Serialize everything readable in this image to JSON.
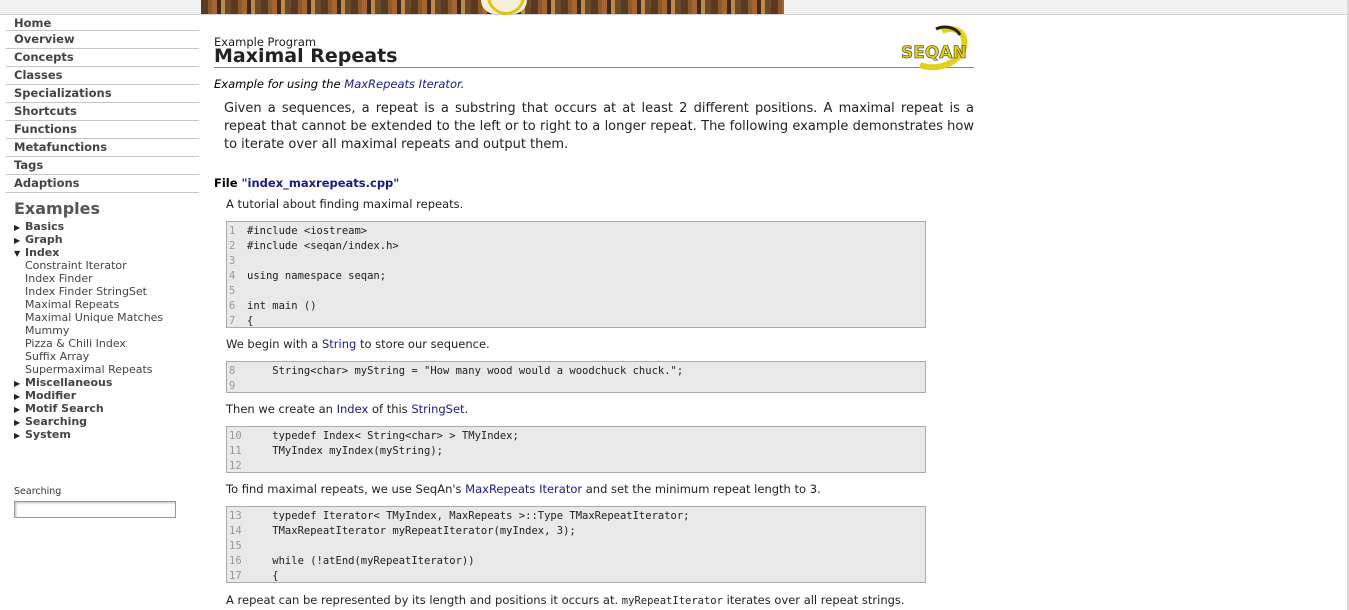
{
  "nav": {
    "items": [
      "Home",
      "Overview",
      "Concepts",
      "Classes",
      "Specializations",
      "Shortcuts",
      "Functions",
      "Metafunctions",
      "Tags",
      "Adaptions"
    ]
  },
  "examples": {
    "heading": "Examples",
    "groups": [
      {
        "label": "Basics",
        "expanded": false
      },
      {
        "label": "Graph",
        "expanded": false
      },
      {
        "label": "Index",
        "expanded": true,
        "children": [
          "Constraint Iterator",
          "Index Finder",
          "Index Finder StringSet",
          "Maximal Repeats",
          "Maximal Unique Matches",
          "Mummy",
          "Pizza & Chili Index",
          "Suffix Array",
          "Supermaximal Repeats"
        ]
      },
      {
        "label": "Miscellaneous",
        "expanded": false
      },
      {
        "label": "Modifier",
        "expanded": false
      },
      {
        "label": "Motif Search",
        "expanded": false
      },
      {
        "label": "Searching",
        "expanded": false
      },
      {
        "label": "System",
        "expanded": false
      }
    ]
  },
  "search": {
    "label": "Searching",
    "value": ""
  },
  "page": {
    "subtitle": "Example Program",
    "title": "Maximal Repeats",
    "logo_text": "SEQAN",
    "lead_prefix": "Example for using the ",
    "lead_link": "MaxRepeats Iterator",
    "lead_suffix": ".",
    "intro": "Given a sequences, a repeat is a substring that occurs at at least 2 different positions. A maximal repeat is a repeat that cannot be extended to the left or to right to a longer repeat. The following example demonstrates how to iterate over all maximal repeats and output them.",
    "file_prefix": "File ",
    "file_name": "\"index_maxrepeats.cpp\""
  },
  "sections": {
    "p1": "A tutorial about finding maximal repeats.",
    "code1": [
      [
        "1",
        "#include <iostream>"
      ],
      [
        "2",
        "#include <seqan/index.h>"
      ],
      [
        "3",
        ""
      ],
      [
        "4",
        "using namespace seqan;"
      ],
      [
        "5",
        ""
      ],
      [
        "6",
        "int main ()"
      ],
      [
        "7",
        "{"
      ]
    ],
    "p2_a": "We begin with a ",
    "p2_link": "String",
    "p2_b": " to store our sequence.",
    "code2": [
      [
        "8",
        "    String<char> myString = \"How many wood would a woodchuck chuck.\";"
      ],
      [
        "9",
        ""
      ]
    ],
    "p3_a": "Then we create an ",
    "p3_link1": "Index",
    "p3_b": " of this ",
    "p3_link2": "StringSet",
    "p3_c": ".",
    "code3": [
      [
        "10",
        "    typedef Index< String<char> > TMyIndex;"
      ],
      [
        "11",
        "    TMyIndex myIndex(myString);"
      ],
      [
        "12",
        ""
      ]
    ],
    "p4_a": "To find maximal repeats, we use SeqAn's ",
    "p4_link": "MaxRepeats Iterator",
    "p4_b": " and set the minimum repeat length to 3.",
    "code4": [
      [
        "13",
        "    typedef Iterator< TMyIndex, MaxRepeats >::Type TMaxRepeatIterator;"
      ],
      [
        "14",
        "    TMaxRepeatIterator myRepeatIterator(myIndex, 3);"
      ],
      [
        "15",
        ""
      ],
      [
        "16",
        "    while (!atEnd(myRepeatIterator))"
      ],
      [
        "17",
        "    {"
      ]
    ],
    "p5_a": "A repeat can be represented by its length and positions it occurs at. ",
    "p5_code": "myRepeatIterator",
    "p5_b": " iterates over all repeat strings."
  }
}
